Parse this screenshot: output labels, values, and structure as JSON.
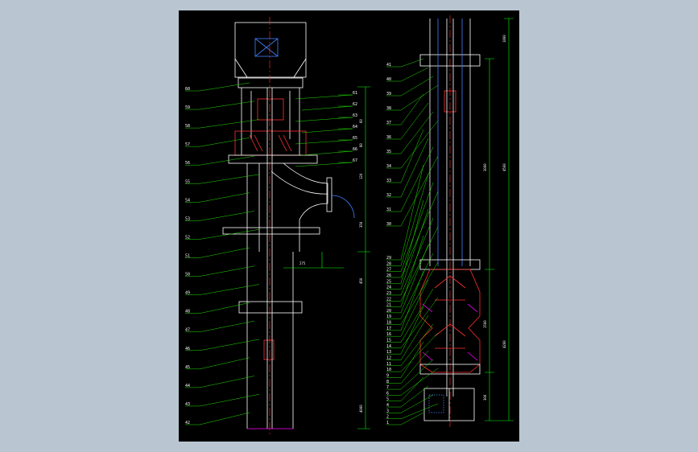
{
  "colors": {
    "frame": "#b9c6d2",
    "sheet": "#000000",
    "outline": "#ffffff",
    "leader": "#22e000",
    "dimension": "#00ff00",
    "centerline": "#ff3030",
    "hatch": "#ff3030",
    "highlight": "#ff00ff",
    "hidden": "#4080ff"
  },
  "left_view": {
    "labels_left": [
      "60",
      "59",
      "58",
      "57",
      "56",
      "55",
      "54",
      "53",
      "52",
      "51",
      "50",
      "49",
      "48",
      "47",
      "46",
      "45",
      "44",
      "43",
      "42"
    ],
    "labels_right": [
      "61",
      "62",
      "63",
      "64",
      "65",
      "66",
      "67"
    ],
    "dimensions": [
      "60",
      "80",
      "120",
      "350",
      "450",
      "275",
      "4000"
    ]
  },
  "right_view": {
    "labels_left": [
      "41",
      "40",
      "39",
      "38",
      "37",
      "36",
      "35",
      "34",
      "33",
      "32",
      "31",
      "30",
      "29",
      "28",
      "27",
      "26",
      "25",
      "24",
      "23",
      "22",
      "21",
      "20",
      "19",
      "18",
      "17",
      "16",
      "15",
      "14",
      "13",
      "12",
      "11",
      "10",
      "9",
      "8",
      "7",
      "6",
      "5",
      "4",
      "3",
      "2",
      "1"
    ],
    "dimensions": [
      "1800",
      "3000",
      "4500",
      "1500",
      "4200",
      "300"
    ]
  }
}
